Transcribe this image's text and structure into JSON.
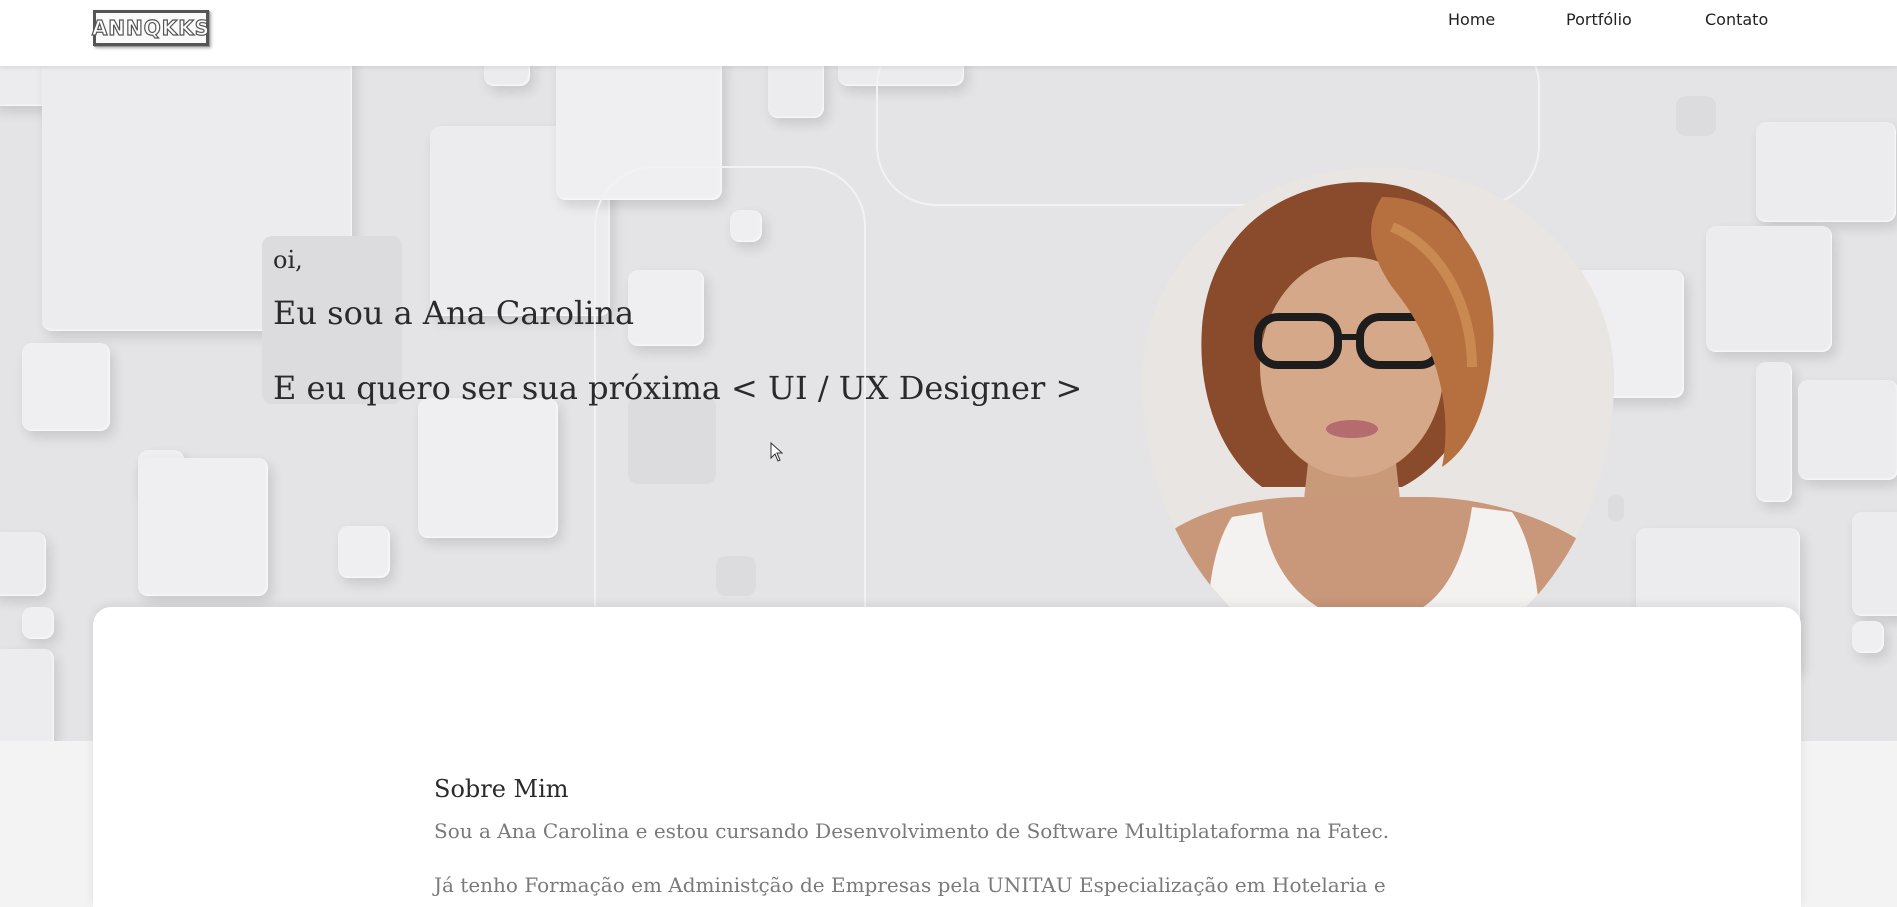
{
  "header": {
    "logo_text": "ANNQKKS",
    "nav": [
      {
        "label": "Home"
      },
      {
        "label": "Portfólio"
      },
      {
        "label": "Contato"
      }
    ]
  },
  "hero": {
    "greeting": "oi,",
    "name_line": "Eu sou a Ana Carolina",
    "tagline": "E eu quero ser sua próxima < UI / UX Designer >",
    "portrait_alt": "Ana Carolina"
  },
  "about": {
    "title": "Sobre Mim",
    "paragraphs": [
      "Sou a Ana Carolina e estou cursando Desenvolvimento de Software Multiplataforma na Fatec.",
      "Já tenho Formação em Administção de Empresas pela UNITAU Especialização em Hotelaria e"
    ]
  },
  "colors": {
    "header_bg": "#ffffff",
    "hero_bg": "#e4e4e6",
    "card_bg": "#ffffff",
    "text_primary": "#2a2a2a",
    "text_muted": "#7a7a7a"
  }
}
